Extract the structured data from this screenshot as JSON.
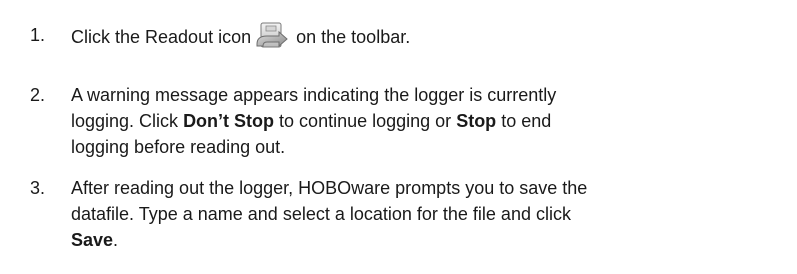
{
  "steps": [
    {
      "number": "1.",
      "pre_icon_text": "Click the Readout icon",
      "icon": "readout-icon",
      "post_icon_text": "on the toolbar."
    },
    {
      "number": "2.",
      "line1": "A warning message appears indicating the logger is currently",
      "line2_pre": "logging. Click ",
      "line2_bold1": "Don’t Stop",
      "line2_mid": " to continue logging or ",
      "line2_bold2": "Stop",
      "line2_post": " to end",
      "line3": "logging before reading out."
    },
    {
      "number": "3.",
      "line1": "After reading out the logger, HOBOware prompts you to save the",
      "line2": "datafile. Type a name and select a location for the file and click",
      "line3_bold": "Save",
      "line3_post": "."
    }
  ]
}
